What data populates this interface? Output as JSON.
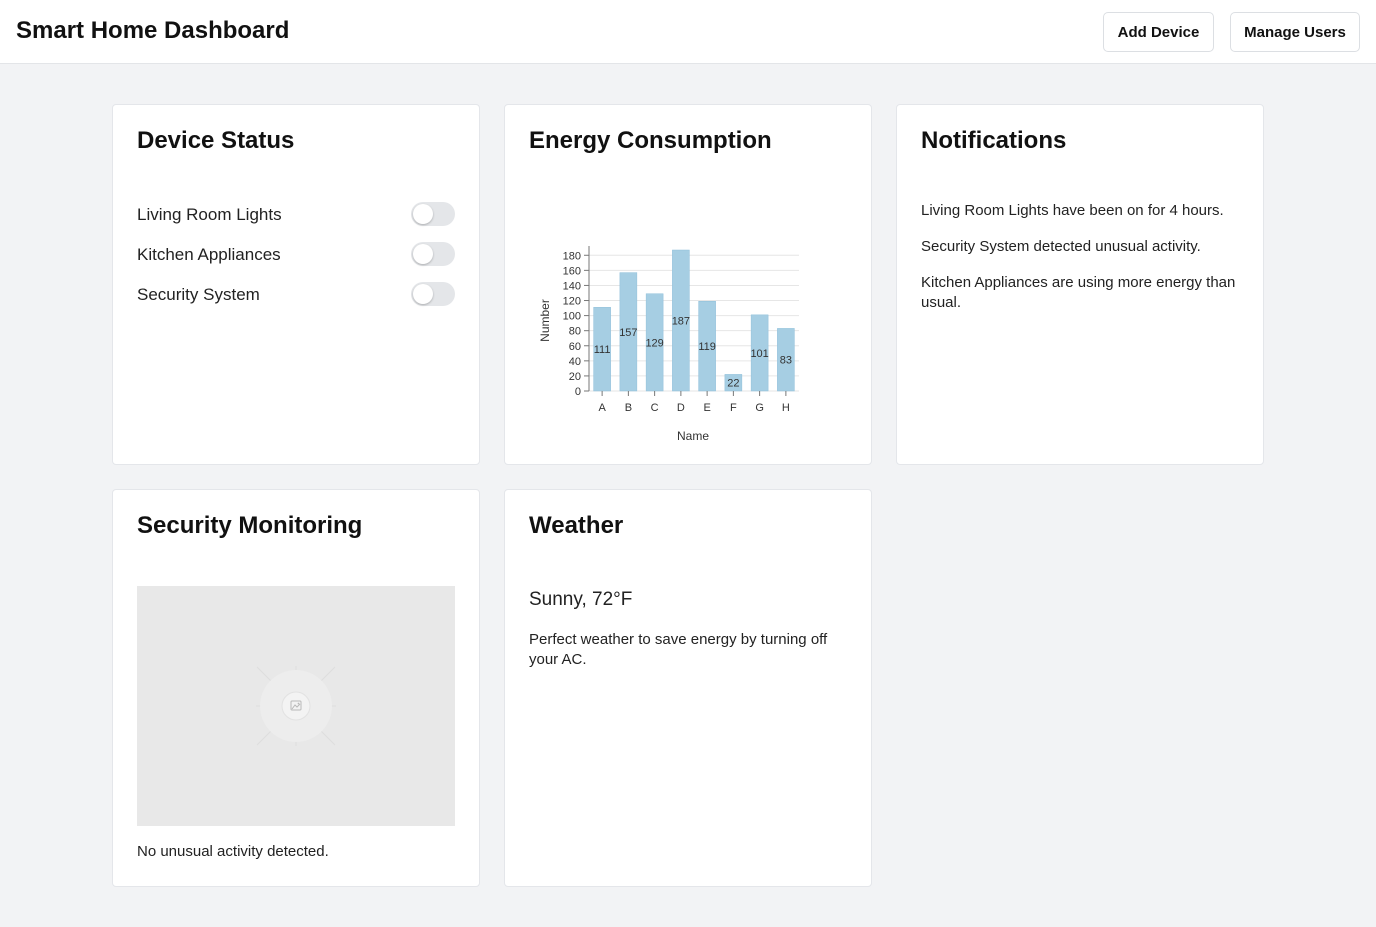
{
  "header": {
    "title": "Smart Home Dashboard",
    "add_device_label": "Add Device",
    "manage_users_label": "Manage Users"
  },
  "device_status": {
    "title": "Device Status",
    "devices": [
      {
        "label": "Living Room Lights",
        "on": false
      },
      {
        "label": "Kitchen Appliances",
        "on": false
      },
      {
        "label": "Security System",
        "on": false
      }
    ]
  },
  "energy": {
    "title": "Energy Consumption"
  },
  "notifications": {
    "title": "Notifications",
    "items": [
      "Living Room Lights have been on for 4 hours.",
      "Security System detected unusual activity.",
      "Kitchen Appliances are using more energy than usual."
    ]
  },
  "security": {
    "title": "Security Monitoring",
    "camera_icon": "image-placeholder-icon",
    "status": "No unusual activity detected."
  },
  "weather": {
    "title": "Weather",
    "summary": "Sunny, 72°F",
    "tip": "Perfect weather to save energy by turning off your AC."
  },
  "colors": {
    "bar": "#a6cee3",
    "toggle_off": "#e4e6e9",
    "background": "#f2f3f5"
  },
  "chart_data": {
    "type": "bar",
    "categories": [
      "A",
      "B",
      "C",
      "D",
      "E",
      "F",
      "G",
      "H"
    ],
    "values": [
      111,
      157,
      129,
      187,
      119,
      22,
      101,
      83
    ],
    "title": "",
    "xlabel": "Name",
    "ylabel": "Number",
    "ylim": [
      0,
      187
    ],
    "yticks": [
      0,
      20,
      40,
      60,
      80,
      100,
      120,
      140,
      160,
      180
    ],
    "grid": true,
    "data_labels": true
  }
}
